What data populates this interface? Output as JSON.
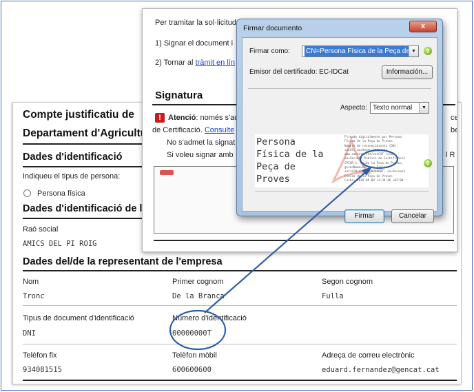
{
  "form": {
    "title": "Compte justificatiu de",
    "department": "Departament d'Agricultu",
    "section_identification": "Dades d'identificació",
    "person_type_prompt": "Indiqueu el tipus de persona:",
    "person_type_option": "Persona física",
    "section_entity": "Dades d'identificació de l'e",
    "company_name_label": "Raó social",
    "company_name_value": "AMICS DEL PI ROIG",
    "section_representative": "Dades del/de la representant de l'empresa",
    "fields": {
      "name_label": "Nom",
      "name_value": "Tronc",
      "surname1_label": "Primer cognom",
      "surname1_value": "De la Branca",
      "surname2_label": "Segon cognom",
      "surname2_value": "Fulla",
      "doc_type_label": "Tipus de document d'identificació",
      "doc_type_value": "DNI",
      "id_number_label": "Número d'identificació",
      "id_number_value": "00000000T",
      "phone_label": "Telèfon fix",
      "phone_value": "934081515",
      "mobile_label": "Telèfon mòbil",
      "mobile_value": "600600600",
      "email_label": "Adreça de correu electrònic",
      "email_value": "eduard.fernandez@gencat.cat"
    }
  },
  "page": {
    "intro": "Per tramitar la sol·licitud",
    "step1": "1)  Signar el document i",
    "step2_prefix": "2)  Tornar al ",
    "step2_link": "tràmit en lín",
    "signature_heading": "Signatura",
    "warning_bold": "Atenció",
    "warning_text": ": només s'ac",
    "right_clip_1": "ce",
    "certification_text": "de Certificació. ",
    "consult_link": "Consulte",
    "right_clip_2": "be",
    "no_accept_text": "No s'admet la signat",
    "right_clip_3": "l R",
    "if_sign_text": "Si voleu signar amb"
  },
  "dialog": {
    "title": "Firmar documento",
    "close_label": "x",
    "sign_as_label": "Firmar como:",
    "sign_as_value": "CN=Persona Física de la Peça de Prove",
    "issuer_label": "Emisor del certificado: EC-IDCat",
    "info_button": "Información...",
    "aspect_label": "Aspecto:",
    "aspect_value": "Texto normal",
    "help_label": "?",
    "preview_name": "Persona\nFísica de la\nPeça de\nProves",
    "preview_details": "Firmado digitalmente por Persona\nFísica de la Peça de Proves\nNombre de reconocimiento (DN):\ncn=SS, ou=Vegeu https://\nwww.catcert.cat/verCAT (c)03,\nou=Serveis Públics de Certificació\nCPISR-1, sn=De la Peça de Proves,\ngivenName=Persona Física,\nserialNumber=00000000T, cn=Persona\nFísica de la Peça de Proves\nFecha: 2010.09.09 12:34:46 +02'00'",
    "sign_button": "Firmar",
    "cancel_button": "Cancelar"
  },
  "colors": {
    "frame_blue": "#3f6fb5",
    "annotation_blue": "#2f5da6",
    "link_blue": "#1a44c8",
    "warning_red": "#c91d1d",
    "help_green": "#5a9e0f",
    "selection_blue": "#3a7bd5"
  },
  "icons": {
    "warning": "exclamation-icon",
    "help": "question-icon",
    "dropdown": "chevron-down-icon",
    "close": "close-icon"
  }
}
